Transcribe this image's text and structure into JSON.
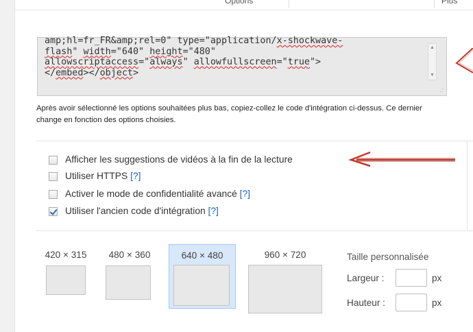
{
  "top": {
    "tab_center": "Options",
    "tab_right": "Plus"
  },
  "embed": {
    "segments": [
      {
        "t": "amp;hl=fr_FR&amp;rel=0\" type=\"application/",
        "s": false
      },
      {
        "t": "x-shockwave-",
        "s": true
      },
      {
        "t": "\n",
        "s": false
      },
      {
        "t": "flash",
        "s": true
      },
      {
        "t": "\" ",
        "s": false
      },
      {
        "t": "width",
        "s": true
      },
      {
        "t": "=\"640\" ",
        "s": false
      },
      {
        "t": "height",
        "s": true
      },
      {
        "t": "=\"480\"\n",
        "s": false
      },
      {
        "t": "allowscriptaccess",
        "s": true
      },
      {
        "t": "=\"",
        "s": false
      },
      {
        "t": "always",
        "s": true
      },
      {
        "t": "\" ",
        "s": false
      },
      {
        "t": "allowfullscreen",
        "s": true
      },
      {
        "t": "=\"",
        "s": false
      },
      {
        "t": "true",
        "s": true
      },
      {
        "t": "\">\n</",
        "s": false
      },
      {
        "t": "embed",
        "s": true
      },
      {
        "t": "></",
        "s": false
      },
      {
        "t": "object",
        "s": true
      },
      {
        "t": ">",
        "s": false
      }
    ]
  },
  "description": "Après avoir sélectionné les options souhaitées plus bas, copiez-collez le code d'intégration ci-dessus. Ce dernier change en fonction des options choisies.",
  "options": [
    {
      "label": "Afficher les suggestions de vidéos à la fin de la lecture",
      "help": "",
      "checked": false
    },
    {
      "label": "Utiliser HTTPS ",
      "help": "[?]",
      "checked": false
    },
    {
      "label": "Activer le mode de confidentialité avancé ",
      "help": "[?]",
      "checked": false
    },
    {
      "label": "Utiliser l'ancien code d'intégration ",
      "help": "[?]",
      "checked": true
    }
  ],
  "sizes": [
    {
      "label": "420 × 315",
      "selected": false
    },
    {
      "label": "480 × 360",
      "selected": false
    },
    {
      "label": "640 × 480",
      "selected": true
    },
    {
      "label": "960 × 720",
      "selected": false
    }
  ],
  "custom": {
    "title": "Taille personnalisée",
    "width_label": "Largeur :",
    "height_label": "Hauteur :",
    "unit": "px",
    "width_value": "",
    "height_value": ""
  },
  "colors": {
    "annotation_arrow": "#c0392b",
    "checkbox_check": "#2f6cc3",
    "selected_size_bg": "#d8e8fb",
    "help_link": "#1c62b9"
  }
}
